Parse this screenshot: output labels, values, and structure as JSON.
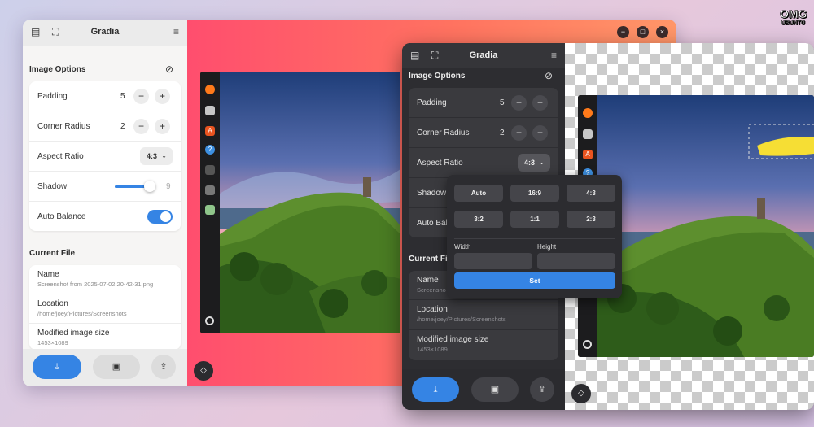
{
  "app_title": "Gradia",
  "sections": {
    "image_options": "Image Options",
    "current_file": "Current File"
  },
  "options": {
    "padding": {
      "label": "Padding",
      "value": "5"
    },
    "corner_radius": {
      "label": "Corner Radius",
      "value": "2"
    },
    "aspect_ratio": {
      "label": "Aspect Ratio",
      "value": "4:3"
    },
    "shadow": {
      "label": "Shadow",
      "value": "9",
      "level": 0.9
    },
    "auto_balance": {
      "label": "Auto Balance",
      "enabled": true
    }
  },
  "file": {
    "name_label": "Name",
    "name_value": "Screenshot from 2025-07-02 20-42-31.png",
    "name_value_short": "Screensho",
    "location_label": "Location",
    "location_value": "/home/joey/Pictures/Screenshots",
    "size_label": "Modified image size",
    "size_value": "1453×1089"
  },
  "popover": {
    "ratios": [
      "Auto",
      "16:9",
      "4:3",
      "3:2",
      "1:1",
      "2:3"
    ],
    "width_label": "Width",
    "height_label": "Height",
    "set_label": "Set"
  },
  "truncated": {
    "shadow": "Shadow",
    "auto_balance": "Auto Bal",
    "current_file": "Current Fi"
  },
  "icons": {
    "minus": "−",
    "plus": "+",
    "chevron": "⌄",
    "menu": "≡"
  },
  "watermark": {
    "line1": "OMG",
    "line2": "UBUNTU"
  },
  "colors": {
    "accent": "#3584e4",
    "canvas_gradient_start": "#ff4e6e",
    "canvas_gradient_end": "#ff9668"
  }
}
